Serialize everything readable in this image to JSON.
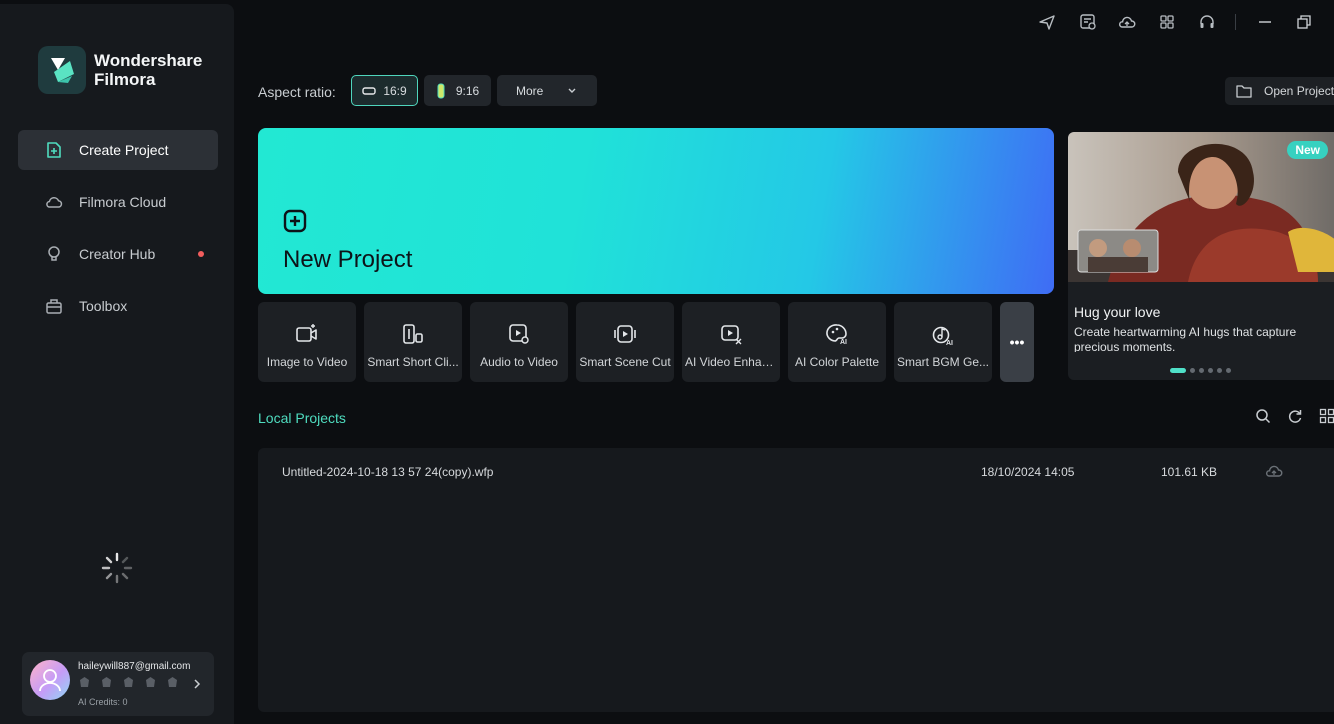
{
  "app": {
    "brand_line1": "Wondershare",
    "brand_line2": "Filmora"
  },
  "sidebar": {
    "items": [
      {
        "label": "Create Project"
      },
      {
        "label": "Filmora Cloud"
      },
      {
        "label": "Creator Hub"
      },
      {
        "label": "Toolbox"
      }
    ]
  },
  "account": {
    "email": "haileywill887@gmail.com",
    "credits": "AI Credits: 0"
  },
  "aspect": {
    "label": "Aspect ratio:",
    "options": [
      "16:9",
      "9:16"
    ],
    "selected": "16:9",
    "more": "More"
  },
  "open_project": "Open Project",
  "new_project": {
    "title": "New Project"
  },
  "tiles": [
    {
      "label": "Image to Video",
      "icon": "image-to-video-icon"
    },
    {
      "label": "Smart Short Cli...",
      "icon": "smart-short-clips-icon"
    },
    {
      "label": "Audio to Video",
      "icon": "audio-to-video-icon"
    },
    {
      "label": "Smart Scene Cut",
      "icon": "smart-scene-cut-icon"
    },
    {
      "label": "AI Video Enhan...",
      "icon": "ai-video-enhancer-icon"
    },
    {
      "label": "AI Color Palette",
      "icon": "ai-color-palette-icon"
    },
    {
      "label": "Smart BGM Ge...",
      "icon": "smart-bgm-icon"
    }
  ],
  "tiles_more": "•••",
  "promo": {
    "badge": "New",
    "title": "Hug your love",
    "description": "Create heartwarming AI hugs that capture precious moments.",
    "slides": 6,
    "active_slide": 1
  },
  "local_projects": {
    "title": "Local Projects",
    "rows": [
      {
        "name": "Untitled-2024-10-18 13 57 24(copy).wfp",
        "date": "18/10/2024 14:05",
        "size": "101.61 KB"
      }
    ]
  },
  "colors": {
    "accent": "#4fdcbf",
    "sidebar_bg": "#16191d",
    "page_bg": "#0c0e11",
    "notification_dot": "#f25d5d"
  }
}
